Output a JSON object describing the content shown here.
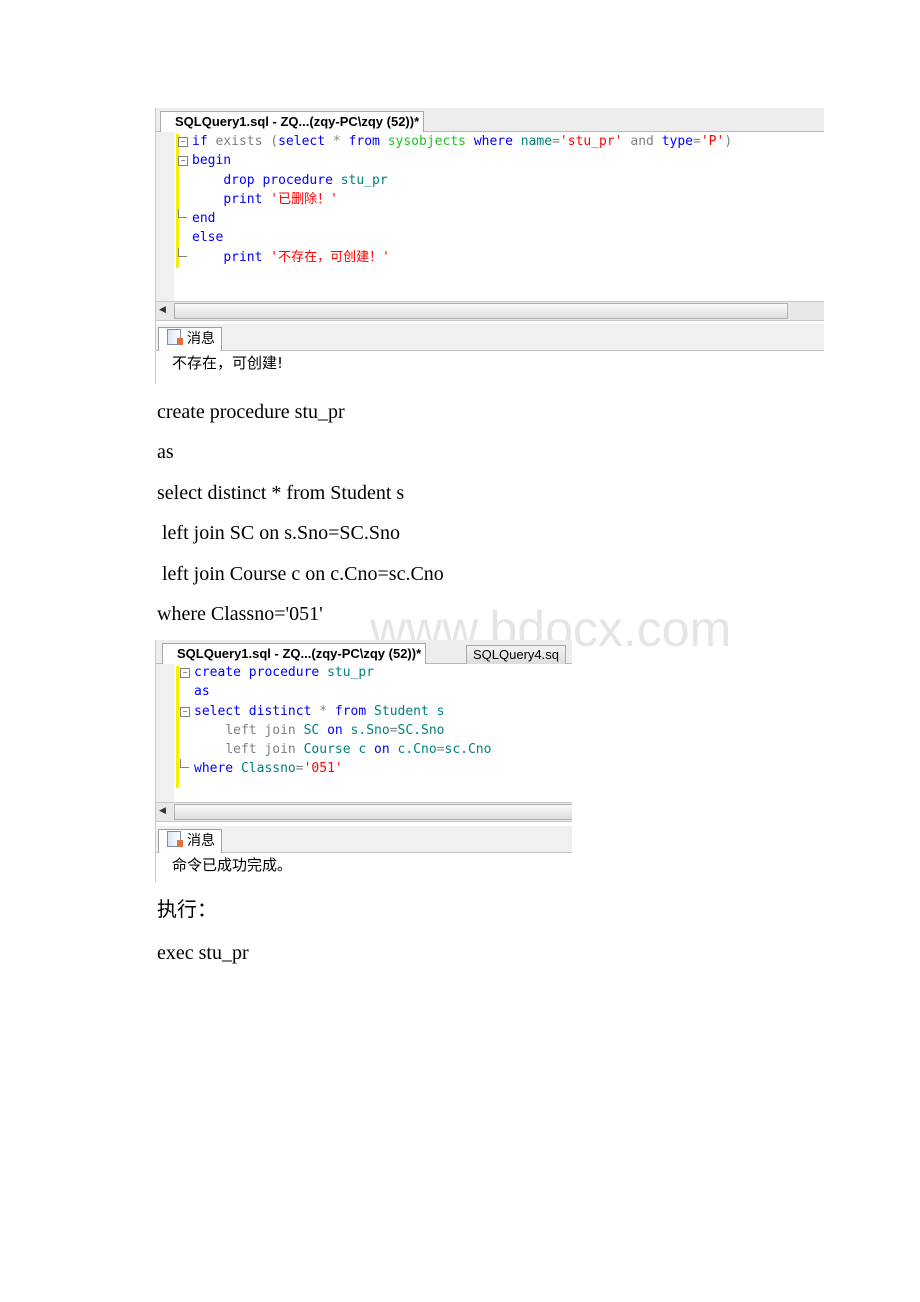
{
  "watermark": "www.bdocx.com",
  "colors": {
    "keyword": "#0000ff",
    "gray": "#808080",
    "system": "#22c022",
    "identifier": "#008080",
    "string": "#ff0000",
    "change_bar": "#f5f000"
  },
  "screenshot1": {
    "tab_title": "SQLQuery1.sql - ZQ...(zqy-PC\\zqy (52))*",
    "code": [
      {
        "fold": "minus",
        "tokens": [
          [
            "if",
            "kw"
          ],
          [
            " exists ",
            "gray"
          ],
          [
            "(",
            "gray"
          ],
          [
            "select",
            "kw"
          ],
          [
            " * ",
            "gray"
          ],
          [
            "from",
            "kw"
          ],
          [
            " ",
            "blk"
          ],
          [
            "sysobjects",
            "grn"
          ],
          [
            " ",
            "blk"
          ],
          [
            "where",
            "kw"
          ],
          [
            " ",
            "blk"
          ],
          [
            "name",
            "teal"
          ],
          [
            "=",
            "gray"
          ],
          [
            "'stu_pr'",
            "red"
          ],
          [
            " and ",
            "gray"
          ],
          [
            "type",
            "kw"
          ],
          [
            "=",
            "gray"
          ],
          [
            "'P'",
            "red"
          ],
          [
            ")",
            "gray"
          ]
        ]
      },
      {
        "fold": "minus",
        "tokens": [
          [
            "begin",
            "kw"
          ]
        ]
      },
      {
        "fold": "",
        "tokens": [
          [
            "    ",
            "blk"
          ],
          [
            "drop",
            "kw"
          ],
          [
            " ",
            "blk"
          ],
          [
            "procedure",
            "kw"
          ],
          [
            " ",
            "blk"
          ],
          [
            "stu_pr",
            "teal"
          ]
        ]
      },
      {
        "fold": "",
        "tokens": [
          [
            "    ",
            "blk"
          ],
          [
            "print",
            "kw"
          ],
          [
            " ",
            "blk"
          ],
          [
            "'已删除！'",
            "red"
          ]
        ]
      },
      {
        "fold": "end",
        "tokens": [
          [
            "end",
            "kw"
          ]
        ]
      },
      {
        "fold": "",
        "tokens": [
          [
            "else",
            "kw"
          ]
        ]
      },
      {
        "fold": "end",
        "tokens": [
          [
            "    ",
            "blk"
          ],
          [
            "print",
            "kw"
          ],
          [
            " ",
            "blk"
          ],
          [
            "'不存在，可创建！'",
            "red"
          ]
        ]
      }
    ],
    "messages_tab": "消息",
    "message": "不存在，可创建!"
  },
  "paragraphs1": [
    "create procedure stu_pr",
    "as",
    "select distinct * from Student s",
    " left join SC on s.Sno=SC.Sno",
    " left join Course c on c.Cno=sc.Cno",
    "where Classno='051'"
  ],
  "screenshot2": {
    "tab_title": "SQLQuery1.sql - ZQ...(zqy-PC\\zqy (52))*",
    "tab2_title": "SQLQuery4.sq",
    "code": [
      {
        "fold": "minus",
        "tokens": [
          [
            "create",
            "kw"
          ],
          [
            " ",
            "blk"
          ],
          [
            "procedure",
            "kw"
          ],
          [
            " ",
            "blk"
          ],
          [
            "stu_pr",
            "teal"
          ]
        ]
      },
      {
        "fold": "",
        "tokens": [
          [
            "as",
            "kw"
          ]
        ]
      },
      {
        "fold": "minus",
        "tokens": [
          [
            "select",
            "kw"
          ],
          [
            " ",
            "blk"
          ],
          [
            "distinct",
            "kw"
          ],
          [
            " * ",
            "gray"
          ],
          [
            "from",
            "kw"
          ],
          [
            " ",
            "blk"
          ],
          [
            "Student",
            "teal"
          ],
          [
            " s",
            "teal"
          ]
        ]
      },
      {
        "fold": "",
        "tokens": [
          [
            "    ",
            "blk"
          ],
          [
            "left join",
            "gray"
          ],
          [
            " ",
            "blk"
          ],
          [
            "SC",
            "teal"
          ],
          [
            " ",
            "blk"
          ],
          [
            "on",
            "kw"
          ],
          [
            " s.Sno",
            "teal"
          ],
          [
            "=",
            "gray"
          ],
          [
            "SC.Sno",
            "teal"
          ]
        ]
      },
      {
        "fold": "",
        "tokens": [
          [
            "    ",
            "blk"
          ],
          [
            "left join",
            "gray"
          ],
          [
            " ",
            "blk"
          ],
          [
            "Course",
            "teal"
          ],
          [
            " c ",
            "teal"
          ],
          [
            "on",
            "kw"
          ],
          [
            " c.Cno",
            "teal"
          ],
          [
            "=",
            "gray"
          ],
          [
            "sc.Cno",
            "teal"
          ]
        ]
      },
      {
        "fold": "end",
        "tokens": [
          [
            "where",
            "kw"
          ],
          [
            " ",
            "blk"
          ],
          [
            "Classno",
            "teal"
          ],
          [
            "=",
            "gray"
          ],
          [
            "'051'",
            "red"
          ]
        ]
      }
    ],
    "messages_tab": "消息",
    "message": "命令已成功完成。"
  },
  "paragraphs2": [
    "执行：",
    "exec stu_pr"
  ]
}
